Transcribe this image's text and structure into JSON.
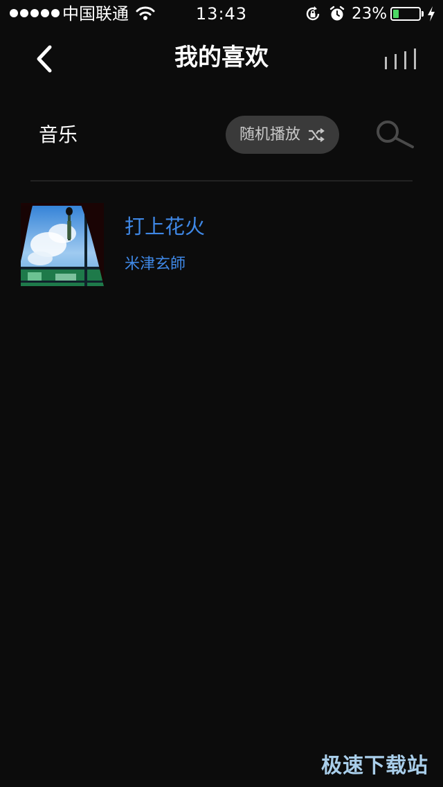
{
  "status_bar": {
    "carrier": "中国联通",
    "time": "13:43",
    "battery_percent": "23%",
    "battery_level": 0.23,
    "battery_color": "#4cd964",
    "icons": [
      "signal-dots-icon",
      "wifi-icon",
      "rotation-lock-icon",
      "alarm-icon",
      "battery-icon",
      "charging-bolt-icon"
    ]
  },
  "nav": {
    "title": "我的喜欢",
    "back_icon": "chevron-left-icon",
    "right_icon": "now-playing-bars-icon"
  },
  "section": {
    "label": "音乐",
    "shuffle_label": "随机播放",
    "shuffle_icon": "shuffle-icon",
    "search_icon": "search-icon"
  },
  "songs": [
    {
      "title": "打上花火",
      "artist": "米津玄師",
      "color": "#3f88e6"
    }
  ],
  "watermark": "极速下载站"
}
